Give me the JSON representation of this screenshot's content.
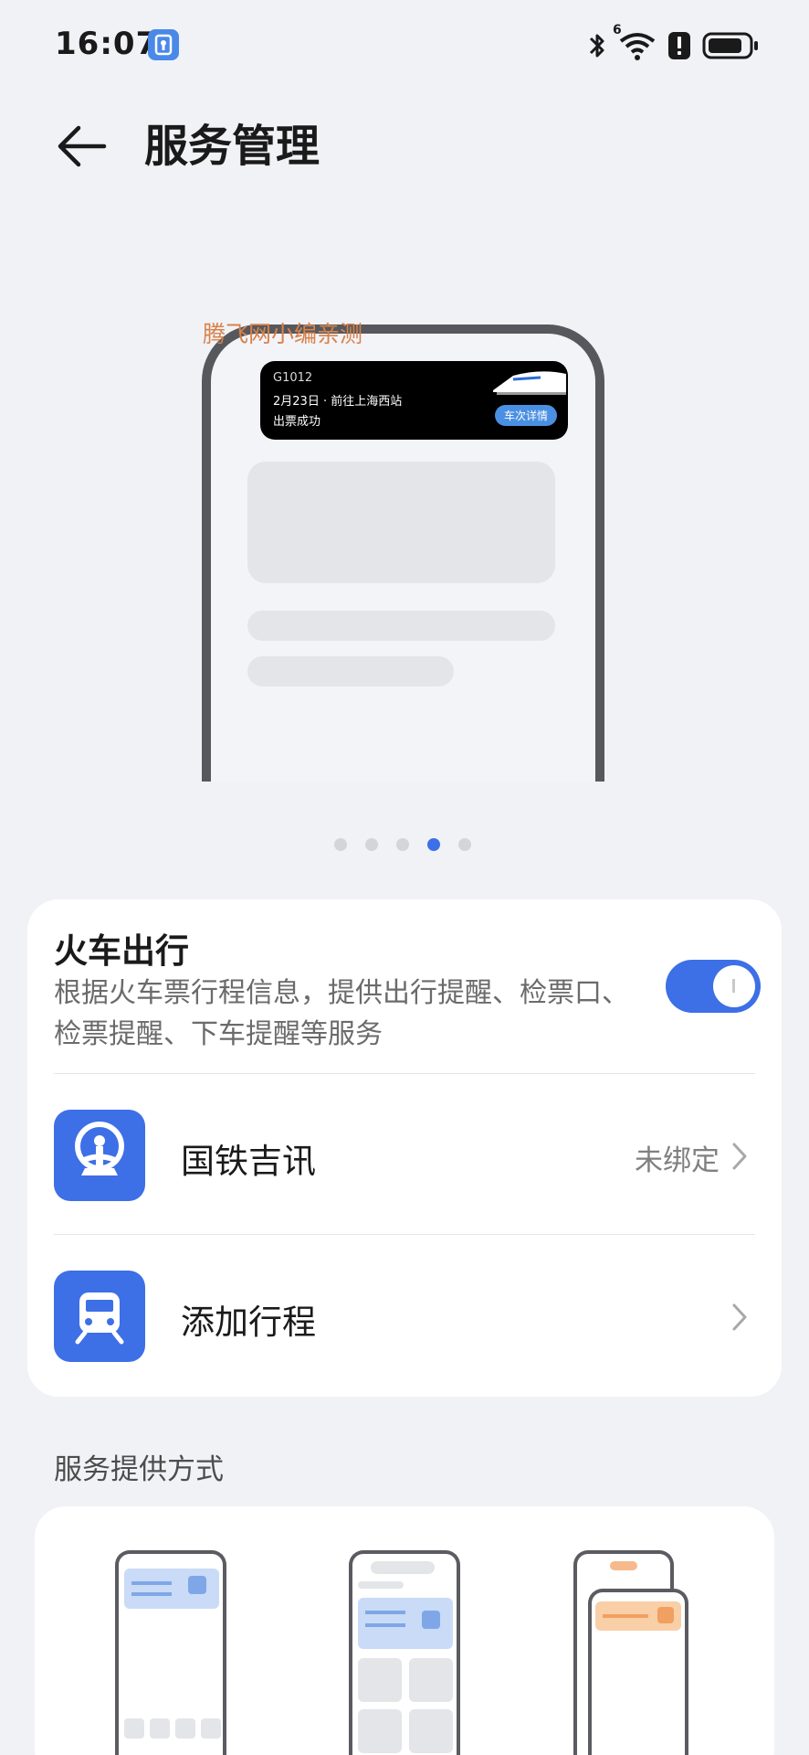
{
  "status_bar": {
    "time": "16:07",
    "network_badge": "6"
  },
  "header": {
    "title": "服务管理"
  },
  "illustration": {
    "watermark": "腾飞网小编亲测",
    "train_number": "G1012",
    "trip_info": "2月23日 · 前往上海西站",
    "ticket_status": "出票成功",
    "details_button": "车次详情",
    "pager_count": 5,
    "pager_active_index": 3
  },
  "train_service": {
    "title": "火车出行",
    "description": "根据火车票行程信息，提供出行提醒、检票口、检票提醒、下车提醒等服务",
    "enabled": true,
    "items": [
      {
        "label": "国铁吉讯",
        "value": "未绑定",
        "icon": "railway-logo-icon"
      },
      {
        "label": "添加行程",
        "value": "",
        "icon": "train-icon"
      }
    ]
  },
  "delivery": {
    "section_title": "服务提供方式"
  },
  "colors": {
    "accent": "#3D6FE6",
    "background": "#F1F2F6",
    "card": "#FFFFFF"
  }
}
